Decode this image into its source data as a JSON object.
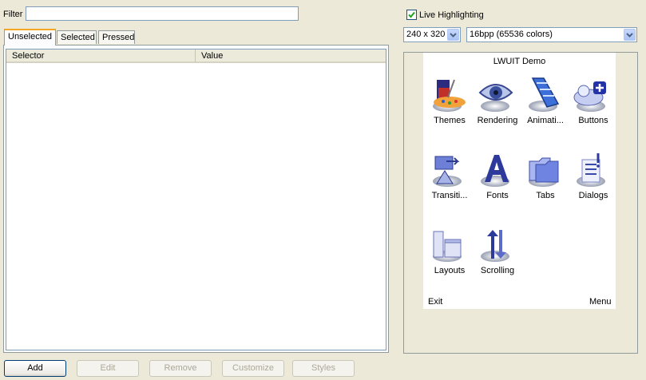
{
  "filter": {
    "label": "Filter",
    "value": ""
  },
  "tabs": [
    {
      "label": "Unselected",
      "active": true
    },
    {
      "label": "Selected",
      "active": false
    },
    {
      "label": "Pressed",
      "active": false
    }
  ],
  "table": {
    "columns": [
      "Selector",
      "Value"
    ],
    "rows": []
  },
  "buttons": {
    "add": "Add",
    "edit": "Edit",
    "remove": "Remove",
    "customize": "Customize",
    "styles": "Styles"
  },
  "live_highlighting": {
    "label": "Live Highlighting",
    "checked": true
  },
  "resolution_select": {
    "value": "240 x 320"
  },
  "color_depth_select": {
    "value": "16bpp (65536 colors)"
  },
  "preview": {
    "title": "LWUIT Demo",
    "apps": [
      {
        "label": "Themes",
        "icon": "palette-icon"
      },
      {
        "label": "Rendering",
        "icon": "eye-icon"
      },
      {
        "label": "Animati...",
        "icon": "film-strip-icon"
      },
      {
        "label": "Buttons",
        "icon": "button-add-icon"
      },
      {
        "label": "Transiti...",
        "icon": "transition-icon"
      },
      {
        "label": "Fonts",
        "icon": "font-letter-icon"
      },
      {
        "label": "Tabs",
        "icon": "folder-tabs-icon"
      },
      {
        "label": "Dialogs",
        "icon": "dialog-list-icon"
      },
      {
        "label": "Layouts",
        "icon": "layout-blocks-icon"
      },
      {
        "label": "Scrolling",
        "icon": "scroll-arrows-icon"
      }
    ],
    "softkeys": {
      "left": "Exit",
      "right": "Menu"
    }
  },
  "colors": {
    "accent_tab": "#f5a623",
    "xp_blue_border": "#7f9db9",
    "window_bg": "#ece9d8"
  }
}
